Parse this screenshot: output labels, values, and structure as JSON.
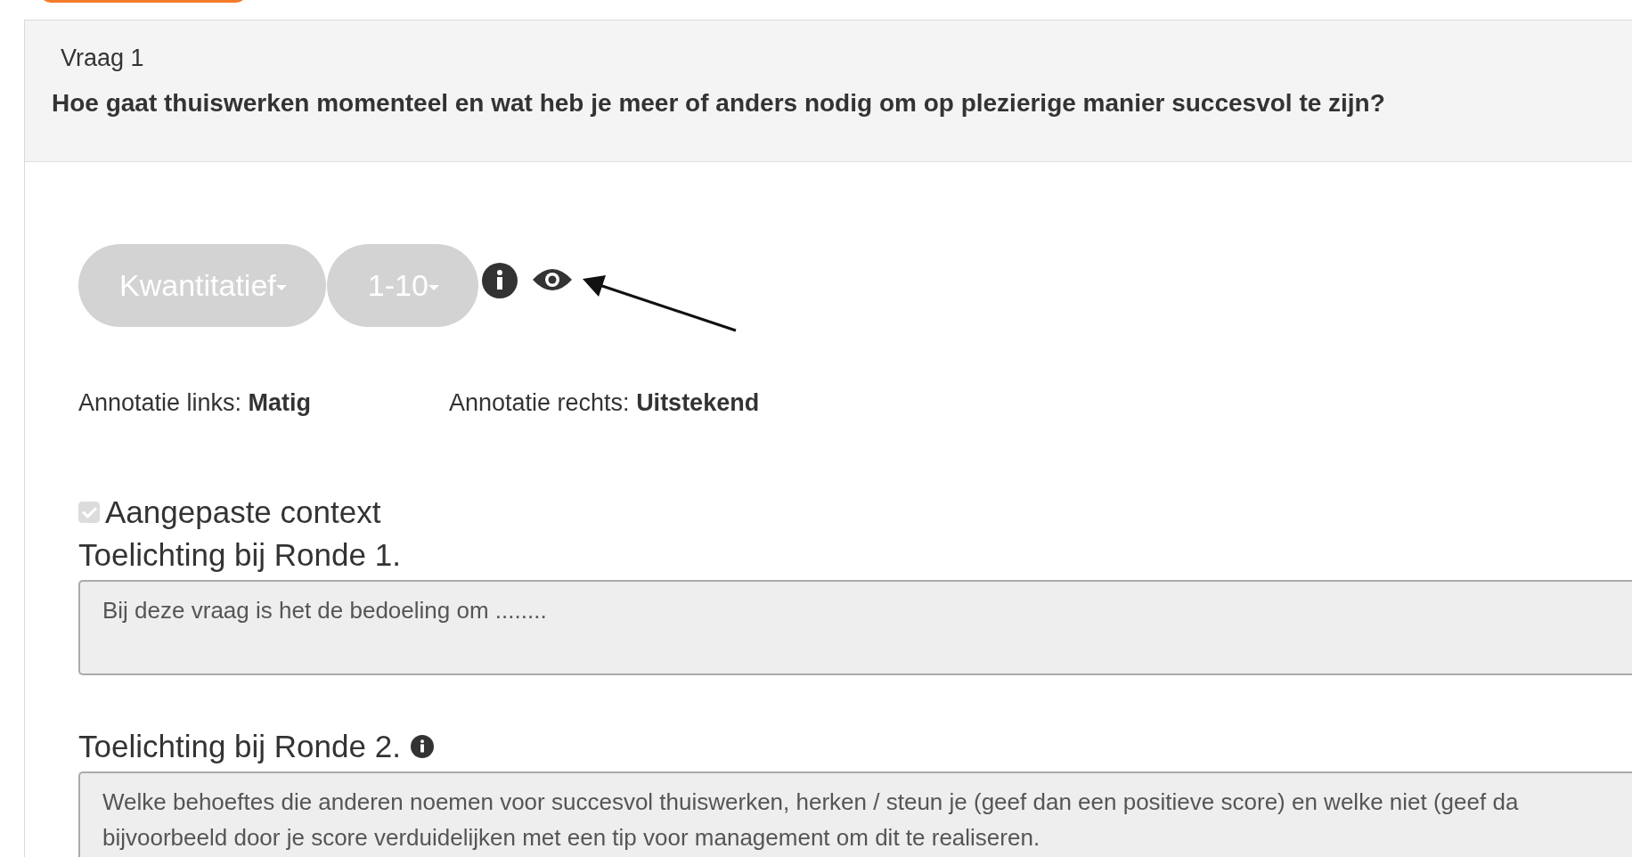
{
  "question": {
    "label": "Vraag 1",
    "text": "Hoe gaat thuiswerken momenteel en wat heb je meer of anders nodig om op plezierige manier succesvol te zijn?"
  },
  "dropdowns": [
    {
      "label": "Kwantitatief",
      "disabled": true
    },
    {
      "label": "1-10",
      "disabled": true
    }
  ],
  "annotations": [
    {
      "label": "Annotatie links: **Matig**"
    },
    {
      "label": "Annotatie rechts: **Uitstekend**"
    }
  ],
  "context": {
    "label": "Aangepaste context",
    "checked": true,
    "disabled": true
  },
  "rounds": [
    {
      "label": "Toelichting bij Ronde 1.",
      "info": false,
      "value": "Bij deze vraag is het de bedoeling om ........"
    },
    {
      "label": "Toelichting bij Ronde 2.",
      "info": true,
      "value": "Welke behoeftes die anderen noemen voor succesvol thuiswerken, herken / steun je (geef dan een positieve score) en welke niet (geef da\nbijvoorbeeld door je score verduidelijken met een tip voor management om dit te realiseren."
    }
  ]
}
